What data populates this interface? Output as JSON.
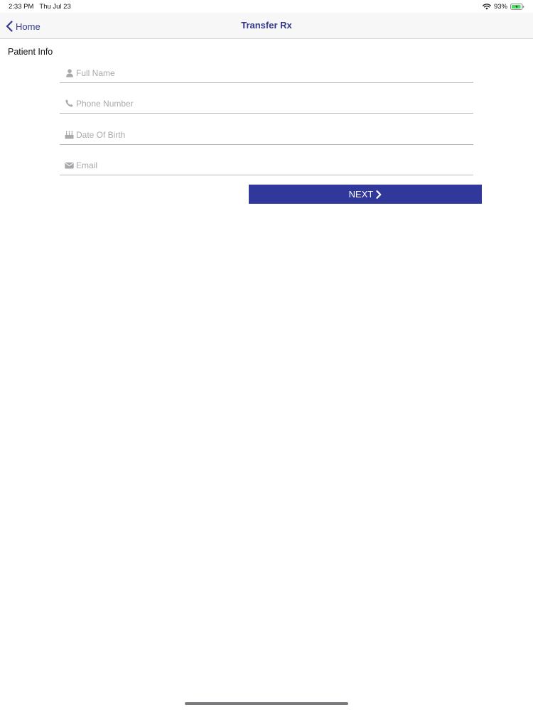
{
  "status_bar": {
    "time": "2:33 PM",
    "date": "Thu Jul 23",
    "battery_percent": "93%",
    "battery_level": 0.93,
    "icons": [
      "wifi-icon",
      "battery-icon"
    ]
  },
  "nav": {
    "back_label": "Home",
    "title": "Transfer Rx",
    "back_icon": "chevron-left-icon"
  },
  "form": {
    "section_title": "Patient Info",
    "fields": [
      {
        "placeholder": "Full Name",
        "value": "",
        "icon": "user-icon"
      },
      {
        "placeholder": "Phone Number",
        "value": "",
        "icon": "phone-icon"
      },
      {
        "placeholder": "Date Of Birth",
        "value": "",
        "icon": "birthday-cake-icon"
      },
      {
        "placeholder": "Email",
        "value": "",
        "icon": "envelope-icon"
      }
    ],
    "next_label": "NEXT",
    "next_icon": "chevron-right-icon"
  },
  "colors": {
    "accent": "#30399b",
    "nav_text": "#33398a",
    "placeholder": "#a9a9ad",
    "battery_green": "#4cd964"
  }
}
